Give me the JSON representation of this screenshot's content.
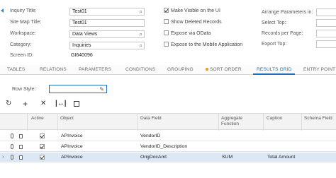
{
  "form": {
    "inquiry_title_label": "Inquiry Title:",
    "inquiry_title_value": "Test01",
    "site_map_title_label": "Site Map Title:",
    "site_map_title_value": "Test01",
    "workspace_label": "Workspace:",
    "workspace_value": "Data Views",
    "category_label": "Category:",
    "category_value": "Inquiries",
    "screen_id_label": "Screen ID:",
    "screen_id_value": "GI640096",
    "make_visible_label": "Make Visible on the UI",
    "show_deleted_label": "Show Deleted Records",
    "expose_odata_label": "Expose via OData",
    "expose_mobile_label": "Expose to the Mobile Application",
    "arrange_params_label": "Arrange Parameters in:",
    "select_top_label": "Select Top:",
    "records_per_page_label": "Records per Page:",
    "export_top_label": "Export Top:"
  },
  "tabs": [
    {
      "label": "TABLES"
    },
    {
      "label": "RELATIONS"
    },
    {
      "label": "PARAMETERS"
    },
    {
      "label": "CONDITIONS"
    },
    {
      "label": "GROUPING"
    },
    {
      "label": "SORT ORDER"
    },
    {
      "label": "RESULTS GRID"
    },
    {
      "label": "ENTRY POINT"
    }
  ],
  "row_style_label": "Row Style:",
  "grid": {
    "headers": {
      "active": "Active",
      "object": "Object",
      "data_field": "Data Field",
      "aggregate_function": "Aggregate Function",
      "caption": "Caption",
      "schema_field": "Schema Field"
    },
    "rows": [
      {
        "object": "APInvoice",
        "data_field": "VendorID",
        "aggregate": "",
        "caption": ""
      },
      {
        "object": "APInvoice",
        "data_field": "VendorID_Description",
        "aggregate": "",
        "caption": ""
      },
      {
        "object": "APInvoice",
        "data_field": "OrigDocAmt",
        "aggregate": "SUM",
        "caption": "Total Amount"
      }
    ]
  },
  "icons": {
    "picker": "magnifier-icon",
    "pencil": "pencil-icon",
    "refresh": "refresh-icon",
    "add": "plus-icon",
    "delete": "x-icon",
    "fit": "fit-columns-icon",
    "export": "export-excel-icon"
  },
  "colors": {
    "accent": "#1f6fc1",
    "selected_row": "#dde8f5",
    "sort_dot": "#e89c1d"
  }
}
